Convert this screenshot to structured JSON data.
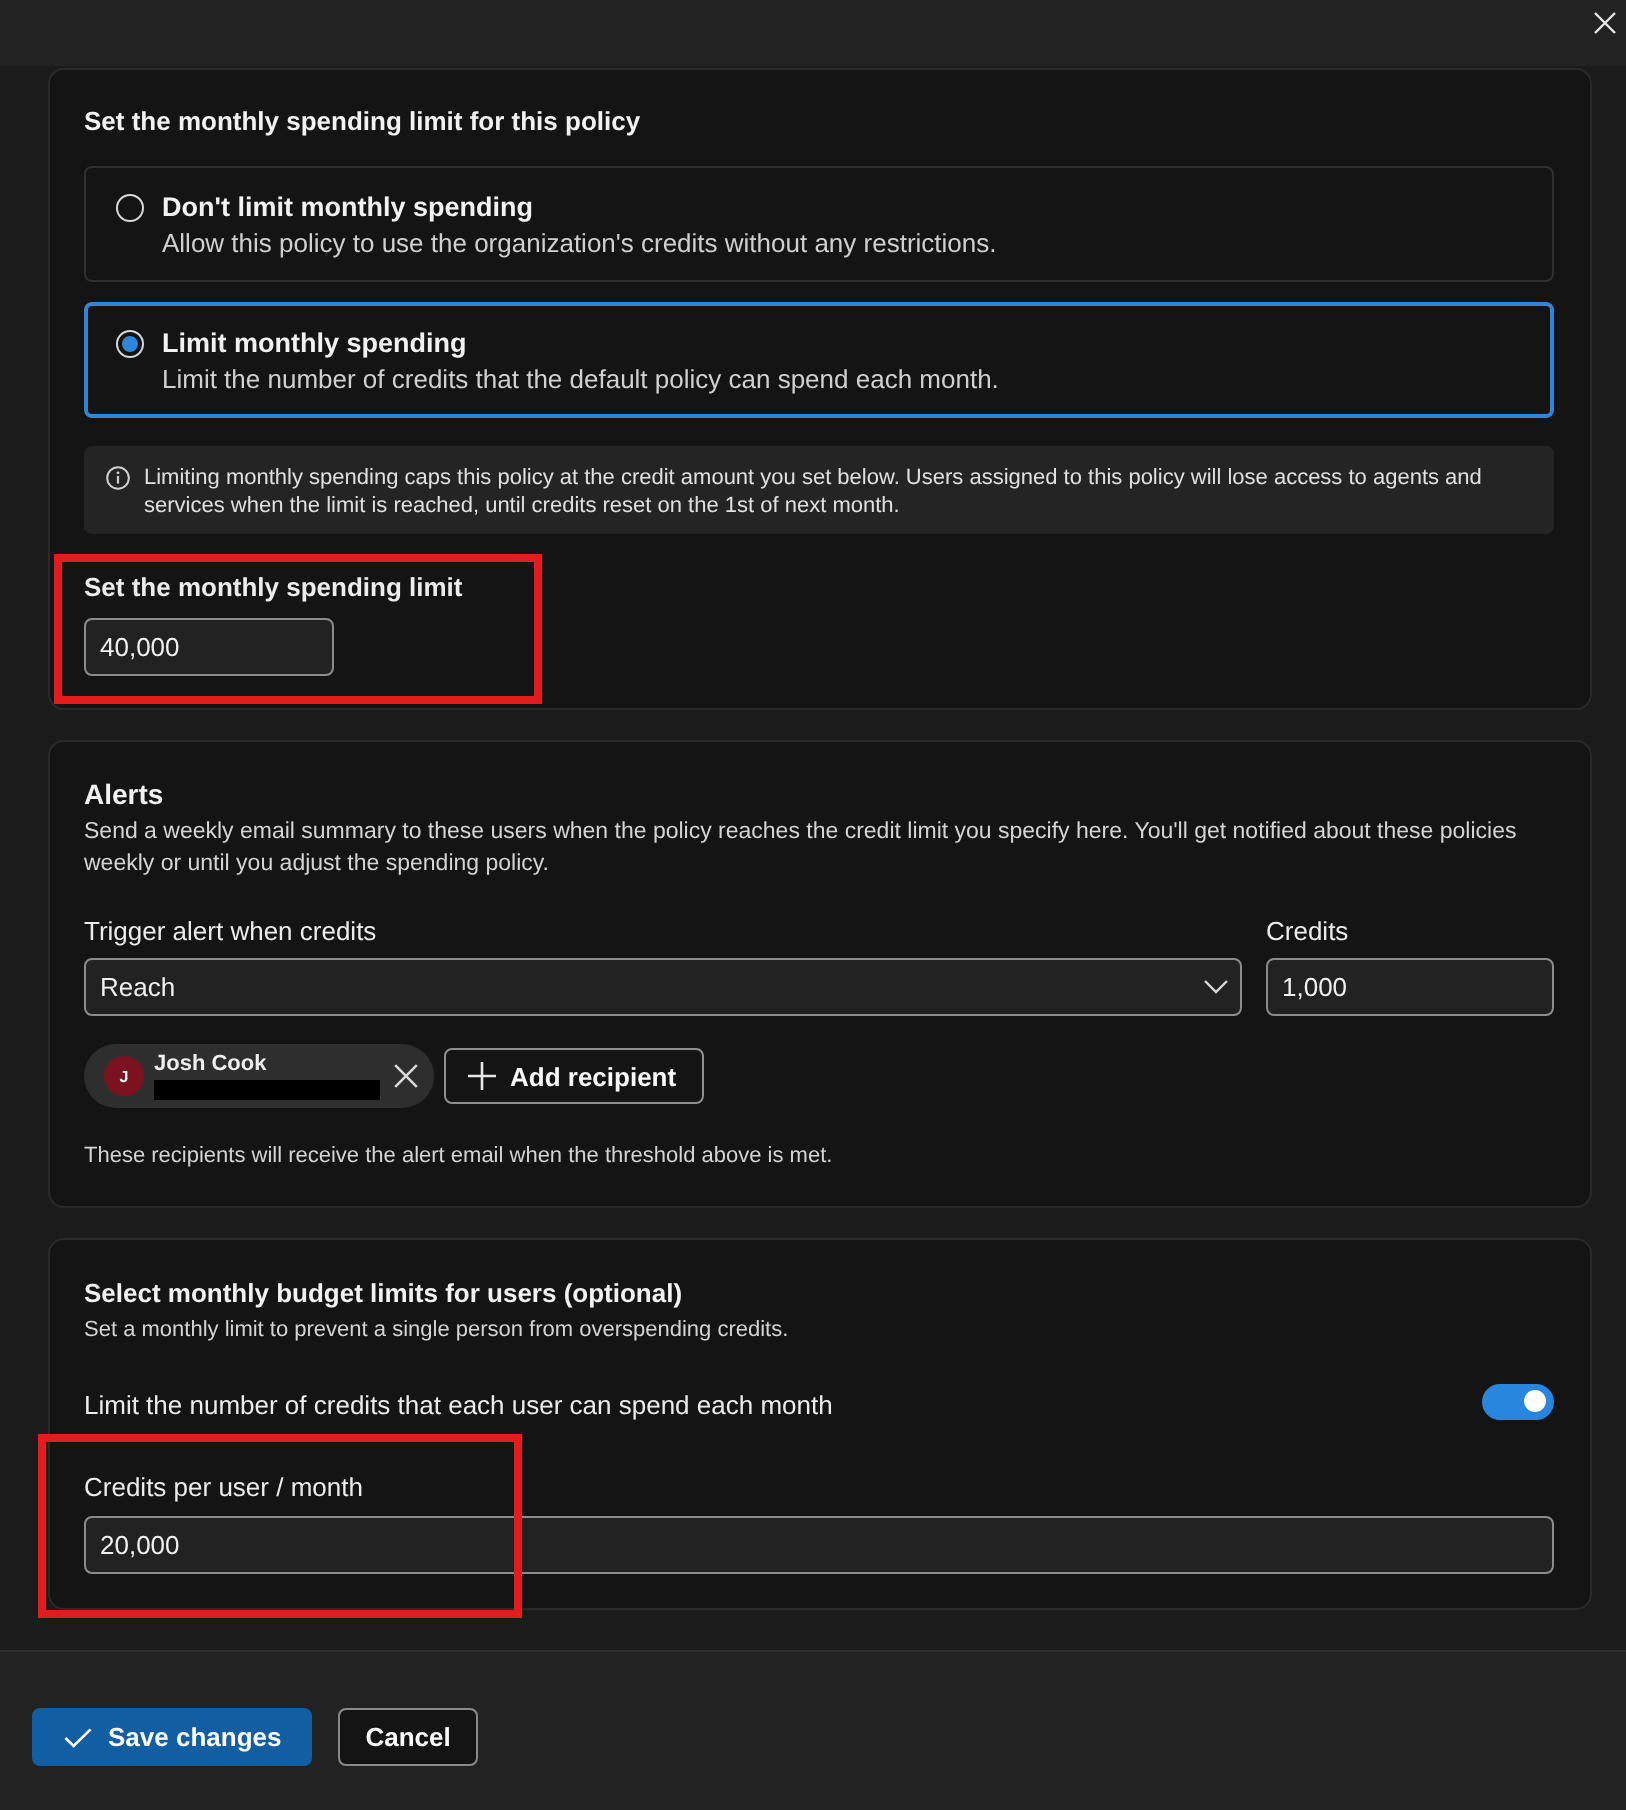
{
  "spending_policy": {
    "title": "Set the monthly spending limit for this policy",
    "options": [
      {
        "label": "Don't limit monthly spending",
        "description": "Allow this policy to use the organization's credits without any restrictions.",
        "selected": false
      },
      {
        "label": "Limit monthly spending",
        "description": "Limit the number of credits that the default policy can spend each month.",
        "selected": true
      }
    ],
    "info": "Limiting monthly spending caps this policy at the credit amount you set below. Users assigned to this policy will lose access to agents and services when the limit is reached, until credits reset on the 1st of next month.",
    "limit_field": {
      "label": "Set the monthly spending limit",
      "value": "40,000",
      "highlighted": true
    }
  },
  "alerts": {
    "title": "Alerts",
    "description": "Send a weekly email summary to these users when the policy reaches the credit limit you specify here. You'll get notified about these policies weekly or until you adjust the spending policy.",
    "trigger": {
      "label": "Trigger alert when credits",
      "value": "Reach"
    },
    "credits": {
      "label": "Credits",
      "value": "1,000"
    },
    "recipients": [
      {
        "initial": "J",
        "name": "Josh Cook",
        "email_redacted": true
      }
    ],
    "add_button": "Add recipient",
    "note": "These recipients will receive the alert email when the threshold above is met."
  },
  "user_limits": {
    "title": "Select monthly budget limits for users (optional)",
    "description": "Set a monthly limit to prevent a single person from overspending credits.",
    "toggle": {
      "label": "Limit the number of credits that each user can spend each month",
      "on": true
    },
    "field": {
      "label": "Credits per user / month",
      "value": "20,000",
      "highlighted": true
    }
  },
  "buttons": [
    {
      "label": "Save changes",
      "kind": "primary"
    },
    {
      "label": "Cancel",
      "kind": "secondary"
    }
  ]
}
